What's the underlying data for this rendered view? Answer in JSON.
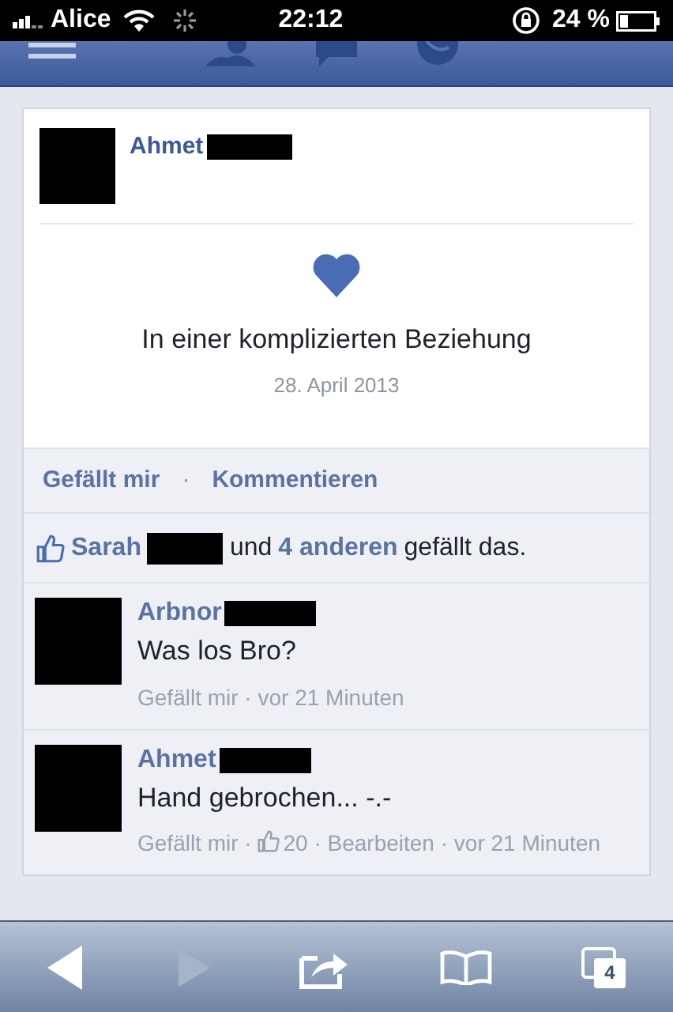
{
  "status_bar": {
    "carrier": "Alice",
    "time": "22:12",
    "battery": "24 %"
  },
  "post": {
    "author": "Ahmet",
    "event": "In einer komplizierten Beziehung",
    "date": "28. April 2013"
  },
  "actions": [
    "Gefällt mir",
    "·",
    "Kommentieren"
  ],
  "likes": [
    {
      "kind": "link",
      "text": "Sarah"
    },
    {
      "kind": "redacted"
    },
    {
      "kind": "text",
      "text": "und"
    },
    {
      "kind": "link",
      "text": "4 anderen"
    },
    {
      "kind": "text",
      "text": "gefällt das."
    }
  ],
  "comments": [
    {
      "author": "Arbnor",
      "text": "Was los Bro?",
      "meta": [
        {
          "kind": "text",
          "text": "Gefällt mir · vor 21 Minuten"
        }
      ]
    },
    {
      "author": "Ahmet",
      "text": "Hand gebrochen... -.-",
      "meta": [
        {
          "kind": "text",
          "text": "Gefällt mir ·"
        },
        {
          "kind": "likes",
          "text": "20"
        },
        {
          "kind": "text",
          "text": "· Bearbeiten · vor 21 Minuten"
        }
      ]
    }
  ],
  "toolbar": {
    "tabs_count": "4"
  }
}
